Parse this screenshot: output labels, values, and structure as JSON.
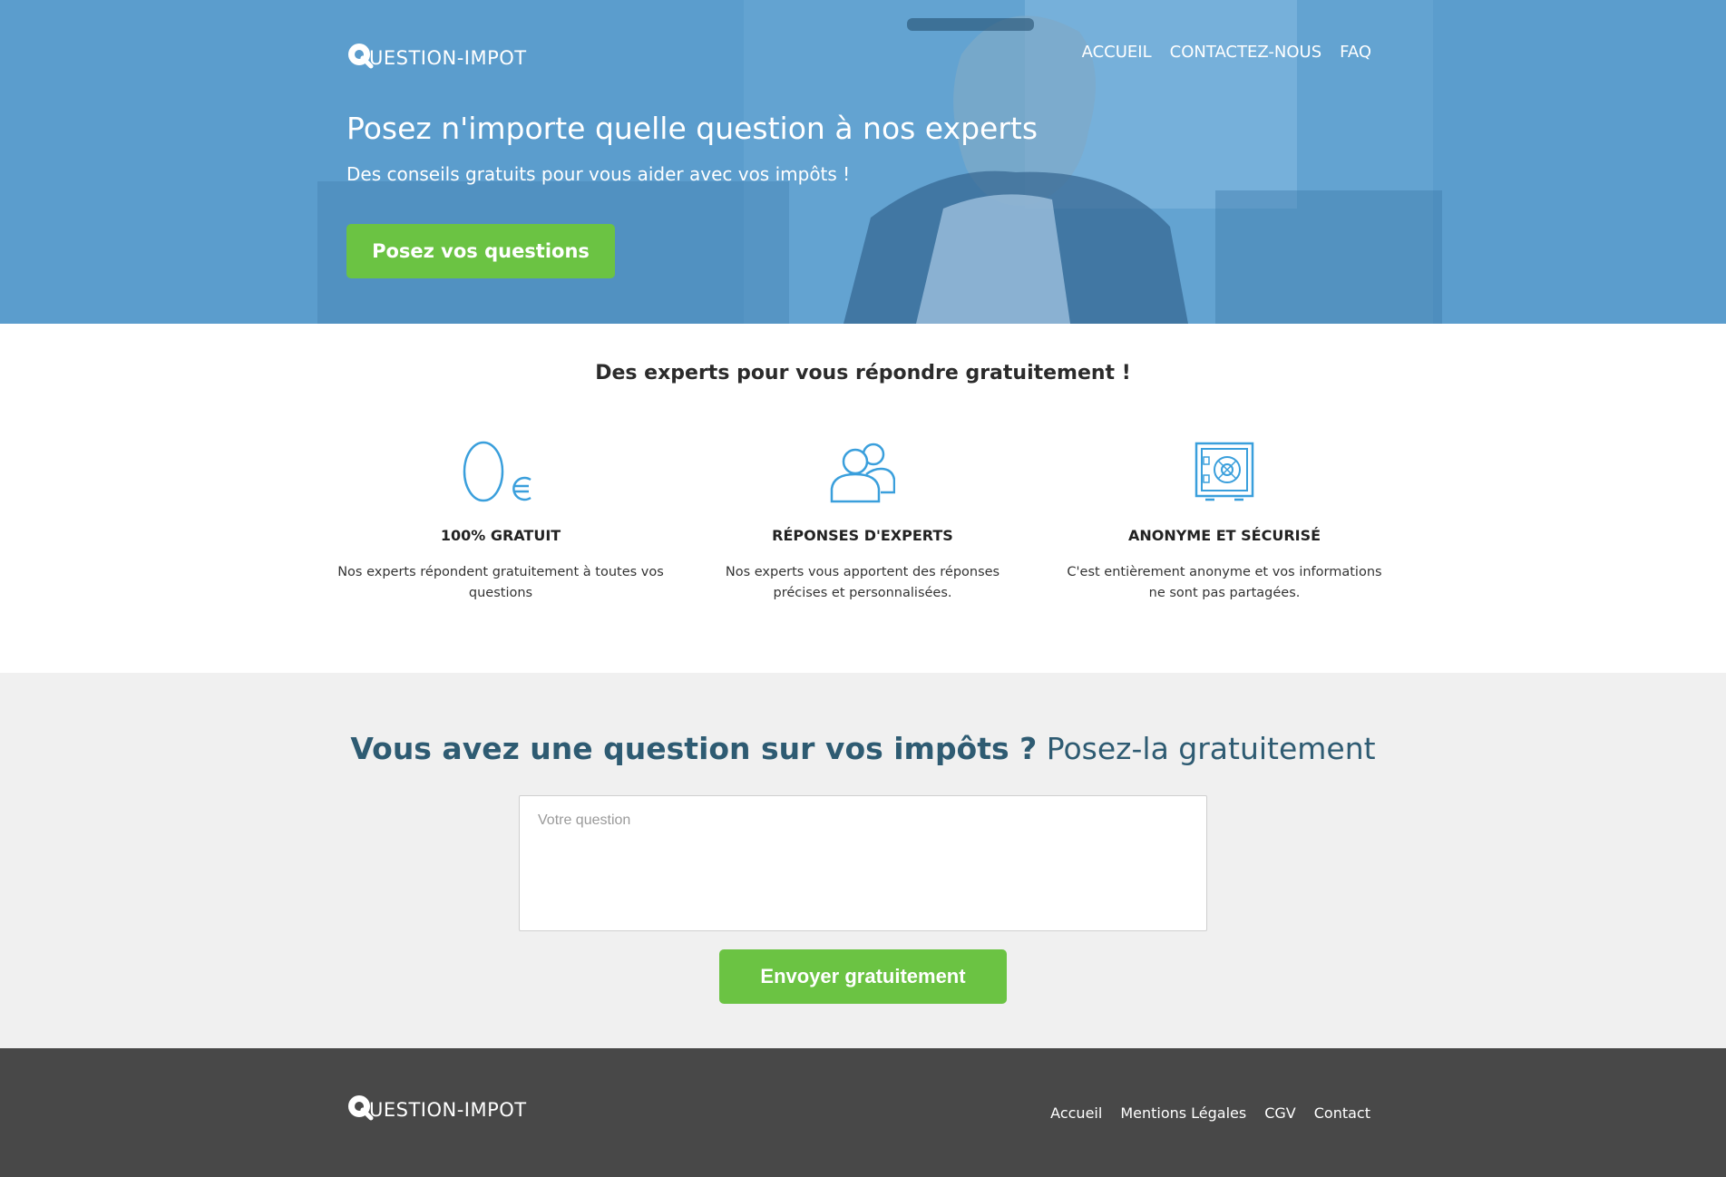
{
  "brand": {
    "logo_letter": "Q",
    "logo_rest": "UESTION-IMPOT"
  },
  "nav": [
    {
      "label": "ACCUEIL"
    },
    {
      "label": "CONTACTEZ-NOUS"
    },
    {
      "label": "FAQ"
    }
  ],
  "hero": {
    "title": "Posez n'importe quelle question à nos experts",
    "subtitle": "Des conseils gratuits pour vous aider avec vos impôts !",
    "cta": "Posez vos questions"
  },
  "features": {
    "title": "Des experts pour vous répondre gratuitement !",
    "items": [
      {
        "icon": "zero-euro-icon",
        "heading": "100% GRATUIT",
        "text": "Nos experts répondent gratuitement à toutes vos questions"
      },
      {
        "icon": "users-icon",
        "heading": "RÉPONSES D'EXPERTS",
        "text": "Nos experts vous apportent des réponses précises et personnalisées."
      },
      {
        "icon": "safe-icon",
        "heading": "ANONYME ET SÉCURISÉ",
        "text": "C'est entièrement anonyme et vos informations ne sont pas partagées."
      }
    ]
  },
  "ask": {
    "title_bold": "Vous avez une question sur vos impôts ?",
    "title_rest": " Posez-la gratuitement",
    "placeholder": "Votre question",
    "value": "",
    "submit": "Envoyer gratuitement"
  },
  "footer": {
    "links": [
      {
        "label": "Accueil"
      },
      {
        "label": "Mentions Légales"
      },
      {
        "label": "CGV"
      },
      {
        "label": "Contact"
      }
    ]
  },
  "colors": {
    "hero_blue": "#5b9ccc",
    "accent_green": "#6bc343",
    "icon_blue": "#3a9fdc",
    "ask_title": "#2e5b72",
    "footer_bg": "#484848"
  }
}
